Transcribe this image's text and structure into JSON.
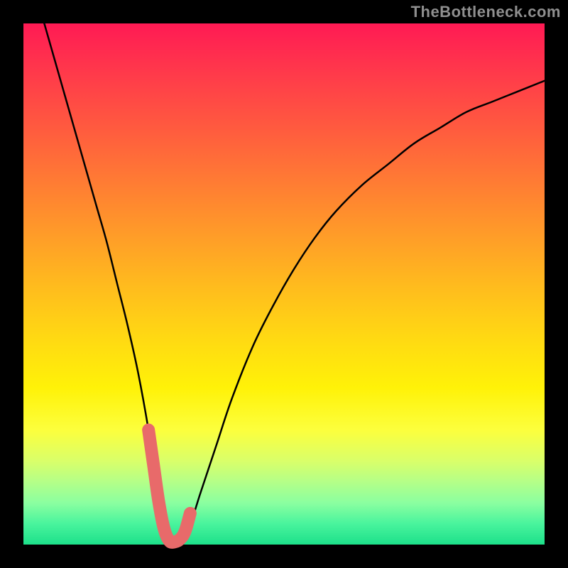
{
  "watermark": "TheBottleneck.com",
  "colors": {
    "frame": "#000000",
    "curve": "#000000",
    "highlight": "#e86a6a",
    "watermark": "#8f8f8f",
    "gradient_top": "#ff1a54",
    "gradient_bottom": "#1de08a"
  },
  "chart_data": {
    "type": "line",
    "title": "",
    "xlabel": "",
    "ylabel": "",
    "xlim": [
      0,
      100
    ],
    "ylim": [
      0,
      100
    ],
    "grid": false,
    "legend": false,
    "annotations": [
      "TheBottleneck.com"
    ],
    "series": [
      {
        "name": "bottleneck-curve",
        "x": [
          4,
          6,
          8,
          10,
          12,
          14,
          16,
          18,
          20,
          22,
          24,
          25,
          26,
          27,
          28,
          29,
          30,
          32,
          34,
          37,
          40,
          44,
          48,
          52,
          56,
          60,
          65,
          70,
          75,
          80,
          85,
          90,
          95,
          100
        ],
        "y": [
          100,
          93,
          86,
          79,
          72,
          65,
          58,
          50,
          42,
          33,
          22,
          15,
          8,
          3,
          0.7,
          0.5,
          1,
          4,
          10,
          19,
          28,
          38,
          46,
          53,
          59,
          64,
          69,
          73,
          77,
          80,
          83,
          85,
          87,
          89
        ]
      },
      {
        "name": "sweet-spot-highlight",
        "x": [
          24,
          25,
          26,
          27,
          28,
          29,
          30,
          31,
          32
        ],
        "y": [
          22,
          15,
          8,
          3,
          0.7,
          0.5,
          1,
          2.5,
          6
        ]
      }
    ]
  }
}
